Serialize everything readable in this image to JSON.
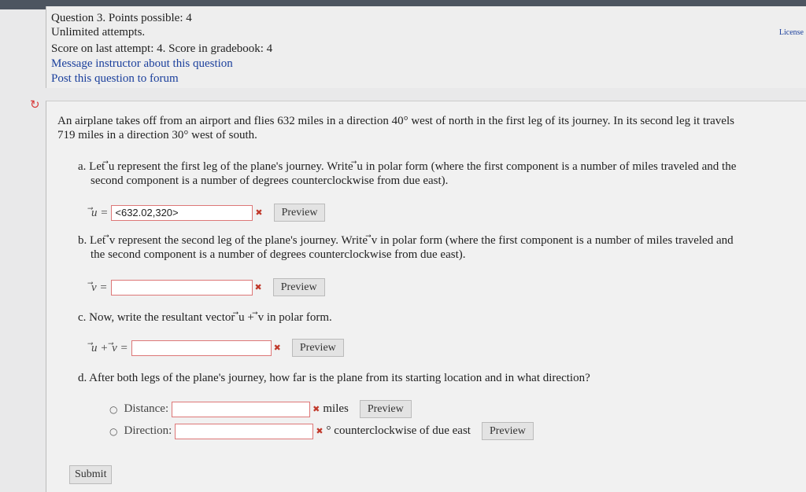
{
  "header": {
    "question_line": "Question 3. Points possible: 4",
    "attempts": "Unlimited attempts.",
    "score": "Score on last attempt: 4. Score in gradebook: 4",
    "message_link": "Message instructor about this question",
    "post_link": "Post this question to forum",
    "license_link": "License"
  },
  "question": {
    "intro_1": "An airplane takes off from an airport and flies 632 miles in a direction 40° west of north in the first leg of its journey. In its second leg it travels",
    "intro_2": "719 miles in a direction 30° west of south.",
    "part_a": {
      "text_1": "a. Let ⃗u represent the first leg of the plane's journey. Write ⃗u in polar form (where the first component is a number of miles traveled and the",
      "text_2": "second component is a number of degrees counterclockwise from due east).",
      "label": "⃗u =",
      "value": "<632.02,320>"
    },
    "part_b": {
      "text_1": "b. Let ⃗v represent the second leg of the plane's journey. Write ⃗v in polar form (where the first component is a number of miles traveled and",
      "text_2": "the second component is a number of degrees counterclockwise from due east).",
      "label": "⃗v =",
      "value": ""
    },
    "part_c": {
      "text": "c. Now, write the resultant vector ⃗u + ⃗v in polar form.",
      "label": "⃗u + ⃗v =",
      "value": ""
    },
    "part_d": {
      "text": "d. After both legs of the plane's journey, how far is the plane from its starting location and in what direction?",
      "distance_label": "Distance:",
      "distance_unit": "miles",
      "direction_label": "Direction:",
      "direction_unit": "° counterclockwise of due east"
    },
    "preview_label": "Preview",
    "submit_label": "Submit"
  },
  "icons": {
    "refresh": "refresh-icon",
    "bullet": "circle-bullet-icon",
    "incorrect": "x-mark-icon"
  },
  "colors": {
    "link": "#1a3f9c",
    "error_border": "#d77",
    "refresh": "#d83a3a"
  }
}
